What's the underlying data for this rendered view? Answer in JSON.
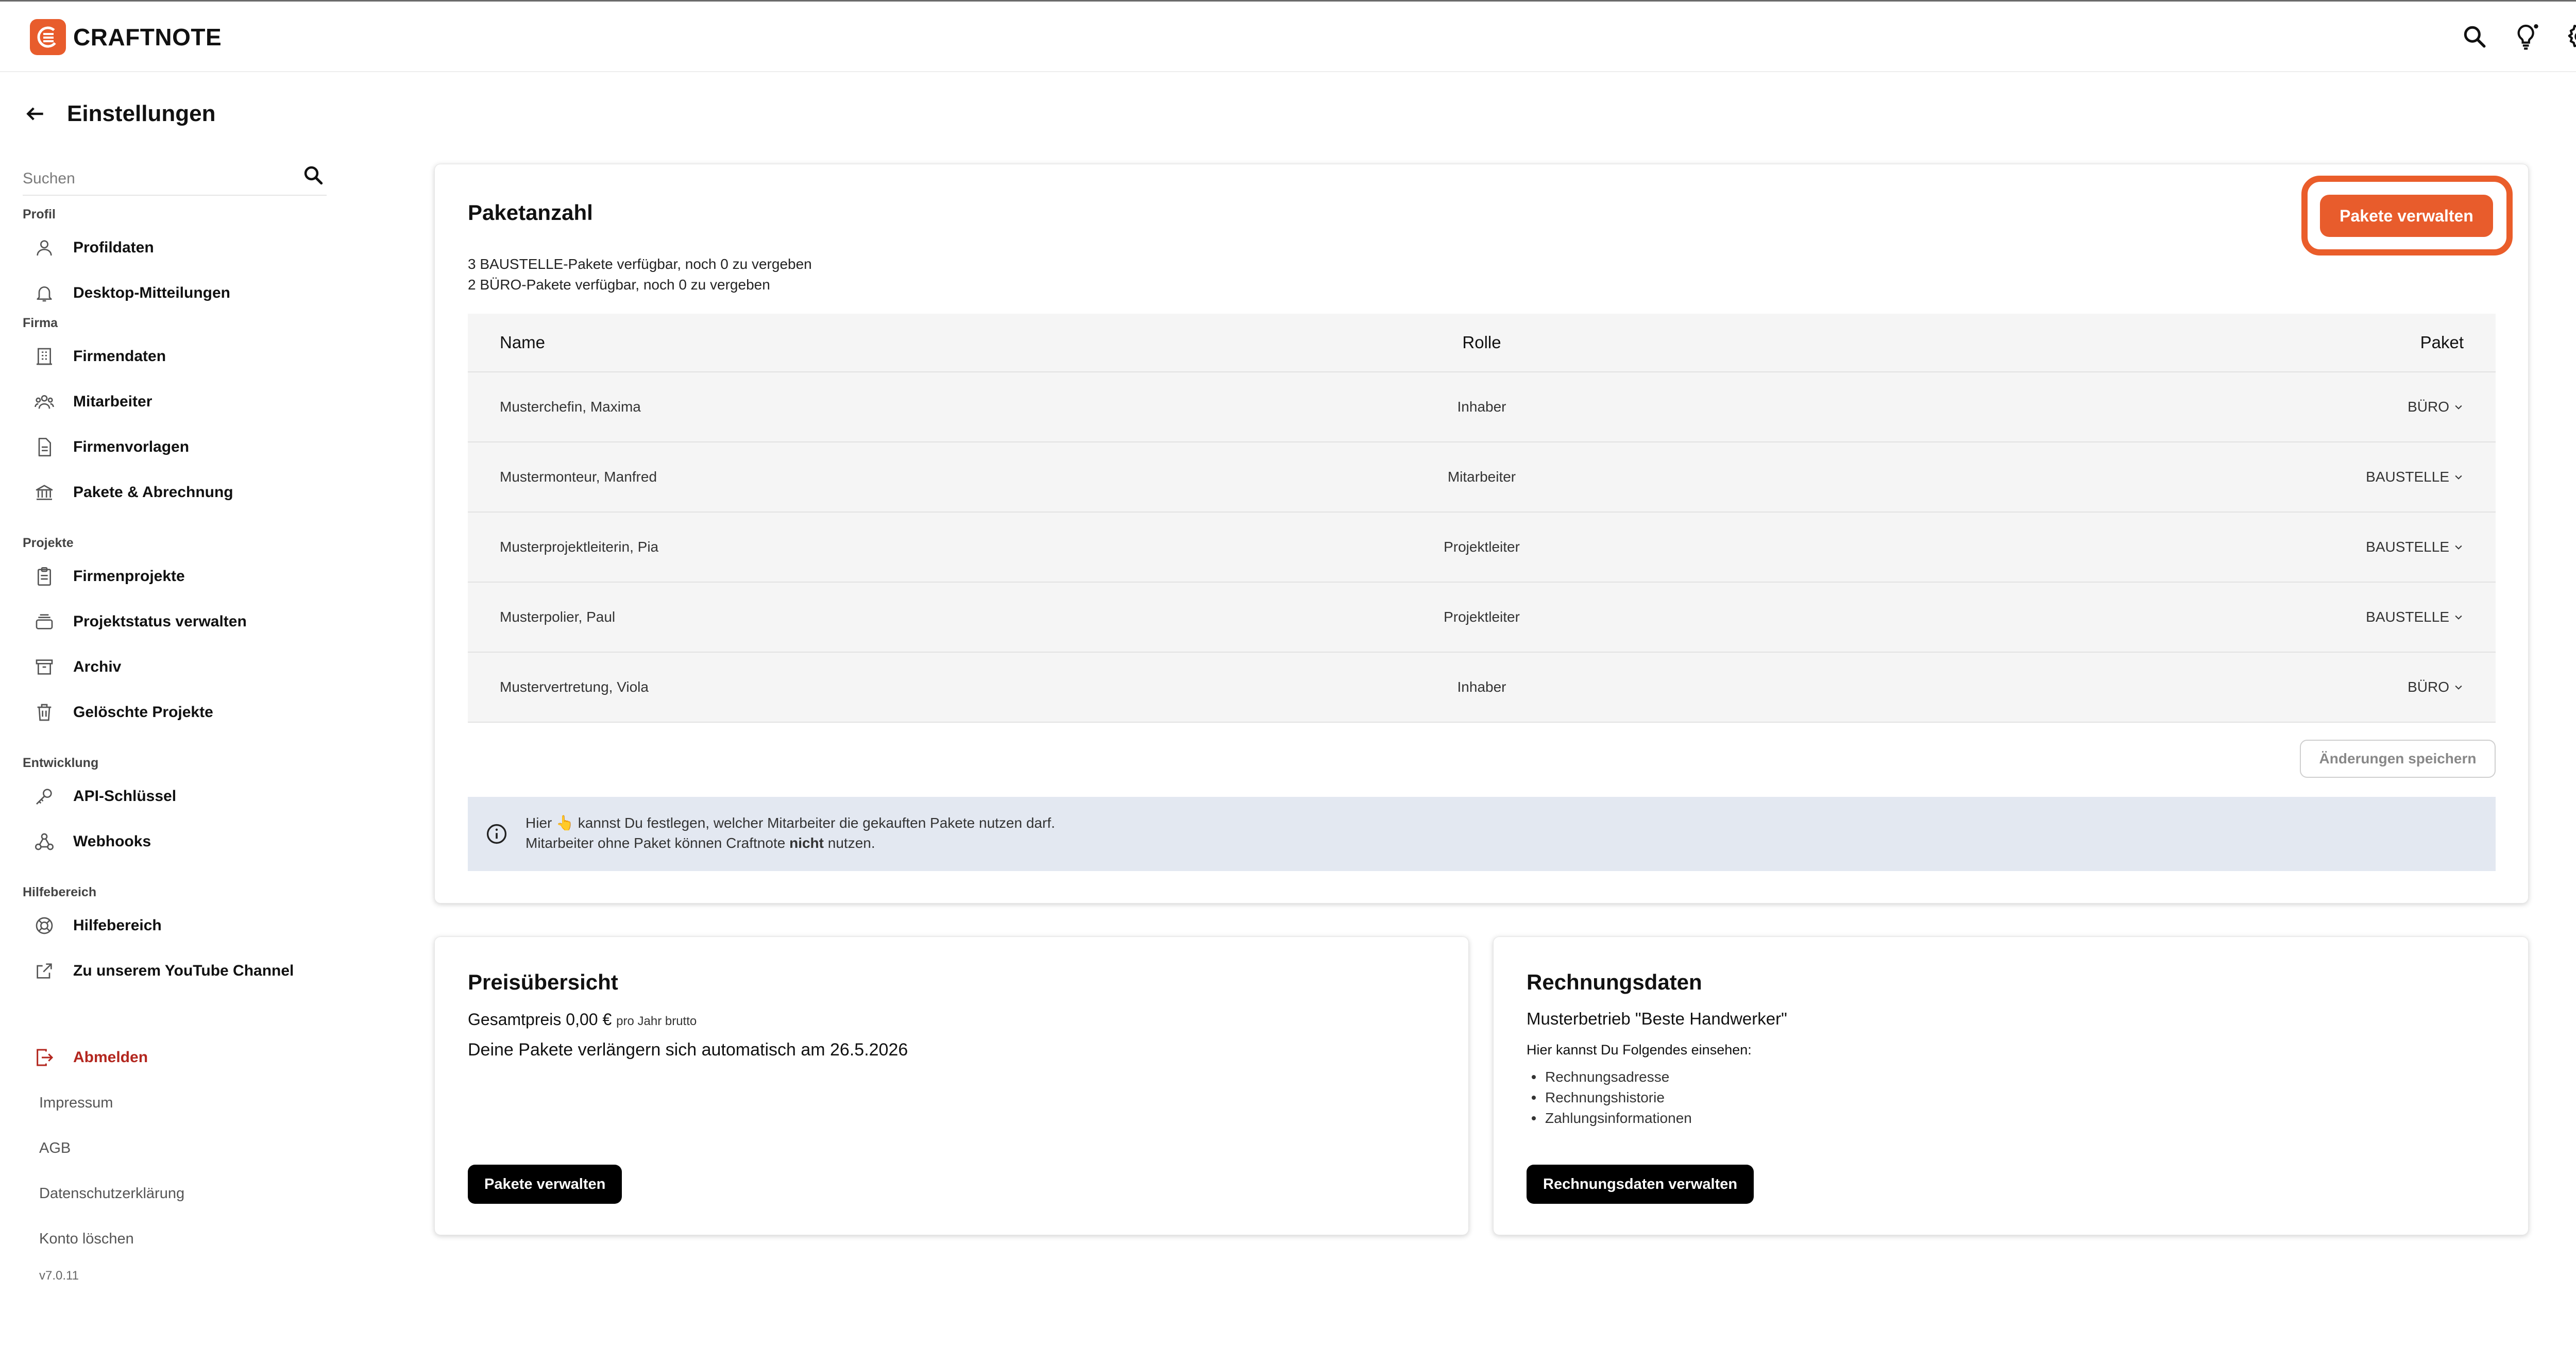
{
  "app": {
    "logo_text": "CRAFTNOTE",
    "brand_color": "#e85c2c"
  },
  "topbar": {
    "icons": [
      "search-icon",
      "lightbulb-icon",
      "gear-icon"
    ]
  },
  "page": {
    "title": "Einstellungen"
  },
  "sidebar": {
    "search_placeholder": "Suchen",
    "sections": [
      {
        "label": "Profil",
        "items": [
          {
            "label": "Profildaten",
            "icon": "user-icon"
          },
          {
            "label": "Desktop-Mitteilungen",
            "icon": "bell-icon"
          }
        ]
      },
      {
        "label": "Firma",
        "items": [
          {
            "label": "Firmendaten",
            "icon": "building-icon"
          },
          {
            "label": "Mitarbeiter",
            "icon": "team-icon"
          },
          {
            "label": "Firmenvorlagen",
            "icon": "document-icon"
          },
          {
            "label": "Pakete & Abrechnung",
            "icon": "bank-icon"
          }
        ]
      },
      {
        "label": "Projekte",
        "items": [
          {
            "label": "Firmenprojekte",
            "icon": "clipboard-icon"
          },
          {
            "label": "Projektstatus verwalten",
            "icon": "stack-icon"
          },
          {
            "label": "Archiv",
            "icon": "archive-icon"
          },
          {
            "label": "Gelöschte Projekte",
            "icon": "trash-icon"
          }
        ]
      },
      {
        "label": "Entwicklung",
        "items": [
          {
            "label": "API-Schlüssel",
            "icon": "key-icon"
          },
          {
            "label": "Webhooks",
            "icon": "webhook-icon"
          }
        ]
      },
      {
        "label": "Hilfebereich",
        "items": [
          {
            "label": "Hilfebereich",
            "icon": "lifebuoy-icon"
          },
          {
            "label": "Zu unserem YouTube Channel",
            "icon": "external-link-icon"
          }
        ]
      }
    ],
    "logout_label": "Abmelden",
    "links": [
      "Impressum",
      "AGB",
      "Datenschutzerklärung",
      "Konto löschen"
    ],
    "version": "v7.0.11"
  },
  "packages": {
    "title": "Paketanzahl",
    "manage_label": "Pakete verwalten",
    "available_lines": [
      "3 BAUSTELLE-Pakete verfügbar, noch 0 zu vergeben",
      "2 BÜRO-Pakete verfügbar, noch 0 zu vergeben"
    ],
    "columns": {
      "name": "Name",
      "role": "Rolle",
      "package": "Paket"
    },
    "rows": [
      {
        "name": "Musterchefin, Maxima",
        "role": "Inhaber",
        "package": "BÜRO"
      },
      {
        "name": "Mustermonteur, Manfred",
        "role": "Mitarbeiter",
        "package": "BAUSTELLE"
      },
      {
        "name": "Musterprojektleiterin, Pia",
        "role": "Projektleiter",
        "package": "BAUSTELLE"
      },
      {
        "name": "Musterpolier, Paul",
        "role": "Projektleiter",
        "package": "BAUSTELLE"
      },
      {
        "name": "Mustervertretung, Viola",
        "role": "Inhaber",
        "package": "BÜRO"
      }
    ],
    "save_label": "Änderungen speichern",
    "info_line1_before": "Hier ",
    "info_hand": "👆",
    "info_line1_after": " kannst Du festlegen, welcher Mitarbeiter die gekauften Pakete nutzen darf.",
    "info_line2_before": "Mitarbeiter ohne Paket können Craftnote ",
    "info_line2_bold": "nicht",
    "info_line2_after": " nutzen."
  },
  "price": {
    "title": "Preisübersicht",
    "total_label": "Gesamtpreis 0,00 €",
    "total_suffix": "pro Jahr brutto",
    "renewal": "Deine Pakete verlängern sich automatisch am 26.5.2026",
    "button_label": "Pakete verwalten"
  },
  "billing": {
    "title": "Rechnungsdaten",
    "company": "Musterbetrieb \"Beste Handwerker\"",
    "hint": "Hier kannst Du Folgendes einsehen:",
    "items": [
      "Rechnungsadresse",
      "Rechnungshistorie",
      "Zahlungsinformationen"
    ],
    "button_label": "Rechnungsdaten verwalten"
  }
}
